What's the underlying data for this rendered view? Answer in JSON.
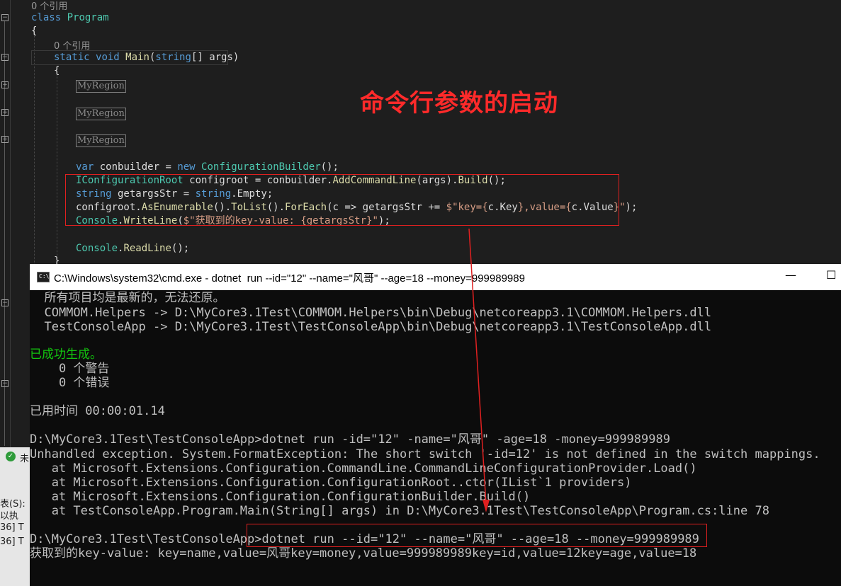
{
  "editor": {
    "refs_class": "0 个引用",
    "refs_main": "0 个引用",
    "region_label": "MyRegion",
    "code": {
      "class_kw": "class",
      "class_name": "Program",
      "brace_open": "{",
      "brace_close": "}",
      "static_kw": "static",
      "void_kw": "void",
      "main_name": "Main",
      "main_open": "(",
      "string_kw": "string",
      "args_sig": "[] args)",
      "var_kw": "var",
      "conbuilder_decl": " conbuilder = ",
      "new_kw": "new",
      "cb_type": "ConfigurationBuilder",
      "cb_tail": "();",
      "iconfig_type": "IConfigurationRoot",
      "configroot_decl": " configroot = conbuilder.",
      "addcmd": "AddCommandLine",
      "addcmd_args": "(args).",
      "build": "Build",
      "build_tail": "();",
      "str_kw": "string",
      "getargs_decl": " getargsStr = ",
      "str_kw2": "string",
      "empty_tail": ".Empty;",
      "line3_a": "configroot.",
      "asenum": "AsEnumerable",
      "paren1": "().",
      "tolist": "ToList",
      "paren2": "().",
      "foreach": "ForEach",
      "line3_b": "(c => getargsStr += ",
      "interp1": "$\"key={",
      "ckey": "c.Key",
      "interp2": "},value={",
      "cvalue": "c.Value",
      "interp3": "}\"",
      "line3_end": ");",
      "console1": "Console",
      "writeline": "WriteLine",
      "wl_open": "(",
      "wl_str": "$\"获取到的key-value: {getargsStr}\"",
      "wl_end": ");",
      "console2": "Console",
      "readline": "ReadLine",
      "rl_end": "();"
    }
  },
  "annotation": {
    "title": "命令行参数的启动",
    "color": "#ff2a2a"
  },
  "cmd_window": {
    "title": "C:\\Windows\\system32\\cmd.exe - dotnet  run --id=\"12\" --name=\"风哥\" --age=18 --money=999989989",
    "minimize": "—",
    "maximize": "☐",
    "lines": {
      "l1": "  所有项目均是最新的，无法还原。",
      "l2": "  COMMOM.Helpers -> D:\\MyCore3.1Test\\COMMOM.Helpers\\bin\\Debug\\netcoreapp3.1\\COMMOM.Helpers.dll",
      "l3": "  TestConsoleApp -> D:\\MyCore3.1Test\\TestConsoleApp\\bin\\Debug\\netcoreapp3.1\\TestConsoleApp.dll",
      "l4": "已成功生成。",
      "l5": "    0 个警告",
      "l6": "    0 个错误",
      "l7": "已用时间 00:00:01.14",
      "l8": "D:\\MyCore3.1Test\\TestConsoleApp>dotnet run -id=\"12\" -name=\"风哥\" -age=18 -money=999989989",
      "l9": "Unhandled exception. System.FormatException: The short switch '-id=12' is not defined in the switch mappings.",
      "l10": "   at Microsoft.Extensions.Configuration.CommandLine.CommandLineConfigurationProvider.Load()",
      "l11": "   at Microsoft.Extensions.Configuration.ConfigurationRoot..ctor(IList`1 providers)",
      "l12": "   at Microsoft.Extensions.Configuration.ConfigurationBuilder.Build()",
      "l13": "   at TestConsoleApp.Program.Main(String[] args) in D:\\MyCore3.1Test\\TestConsoleApp\\Program.cs:line 78",
      "l14": "D:\\MyCore3.1Test\\TestConsoleApp>dotnet run --id=\"12\" --name=\"风哥\" --age=18 --money=999989989",
      "l15": "获取到的key-value: key=name,value=风哥key=money,value=999989989key=id,value=12key=age,value=18"
    }
  },
  "side_panel": {
    "t1": "未",
    "t2": "表(S):",
    "t3": "以执",
    "t4": "36] T",
    "t5": "36] T"
  }
}
